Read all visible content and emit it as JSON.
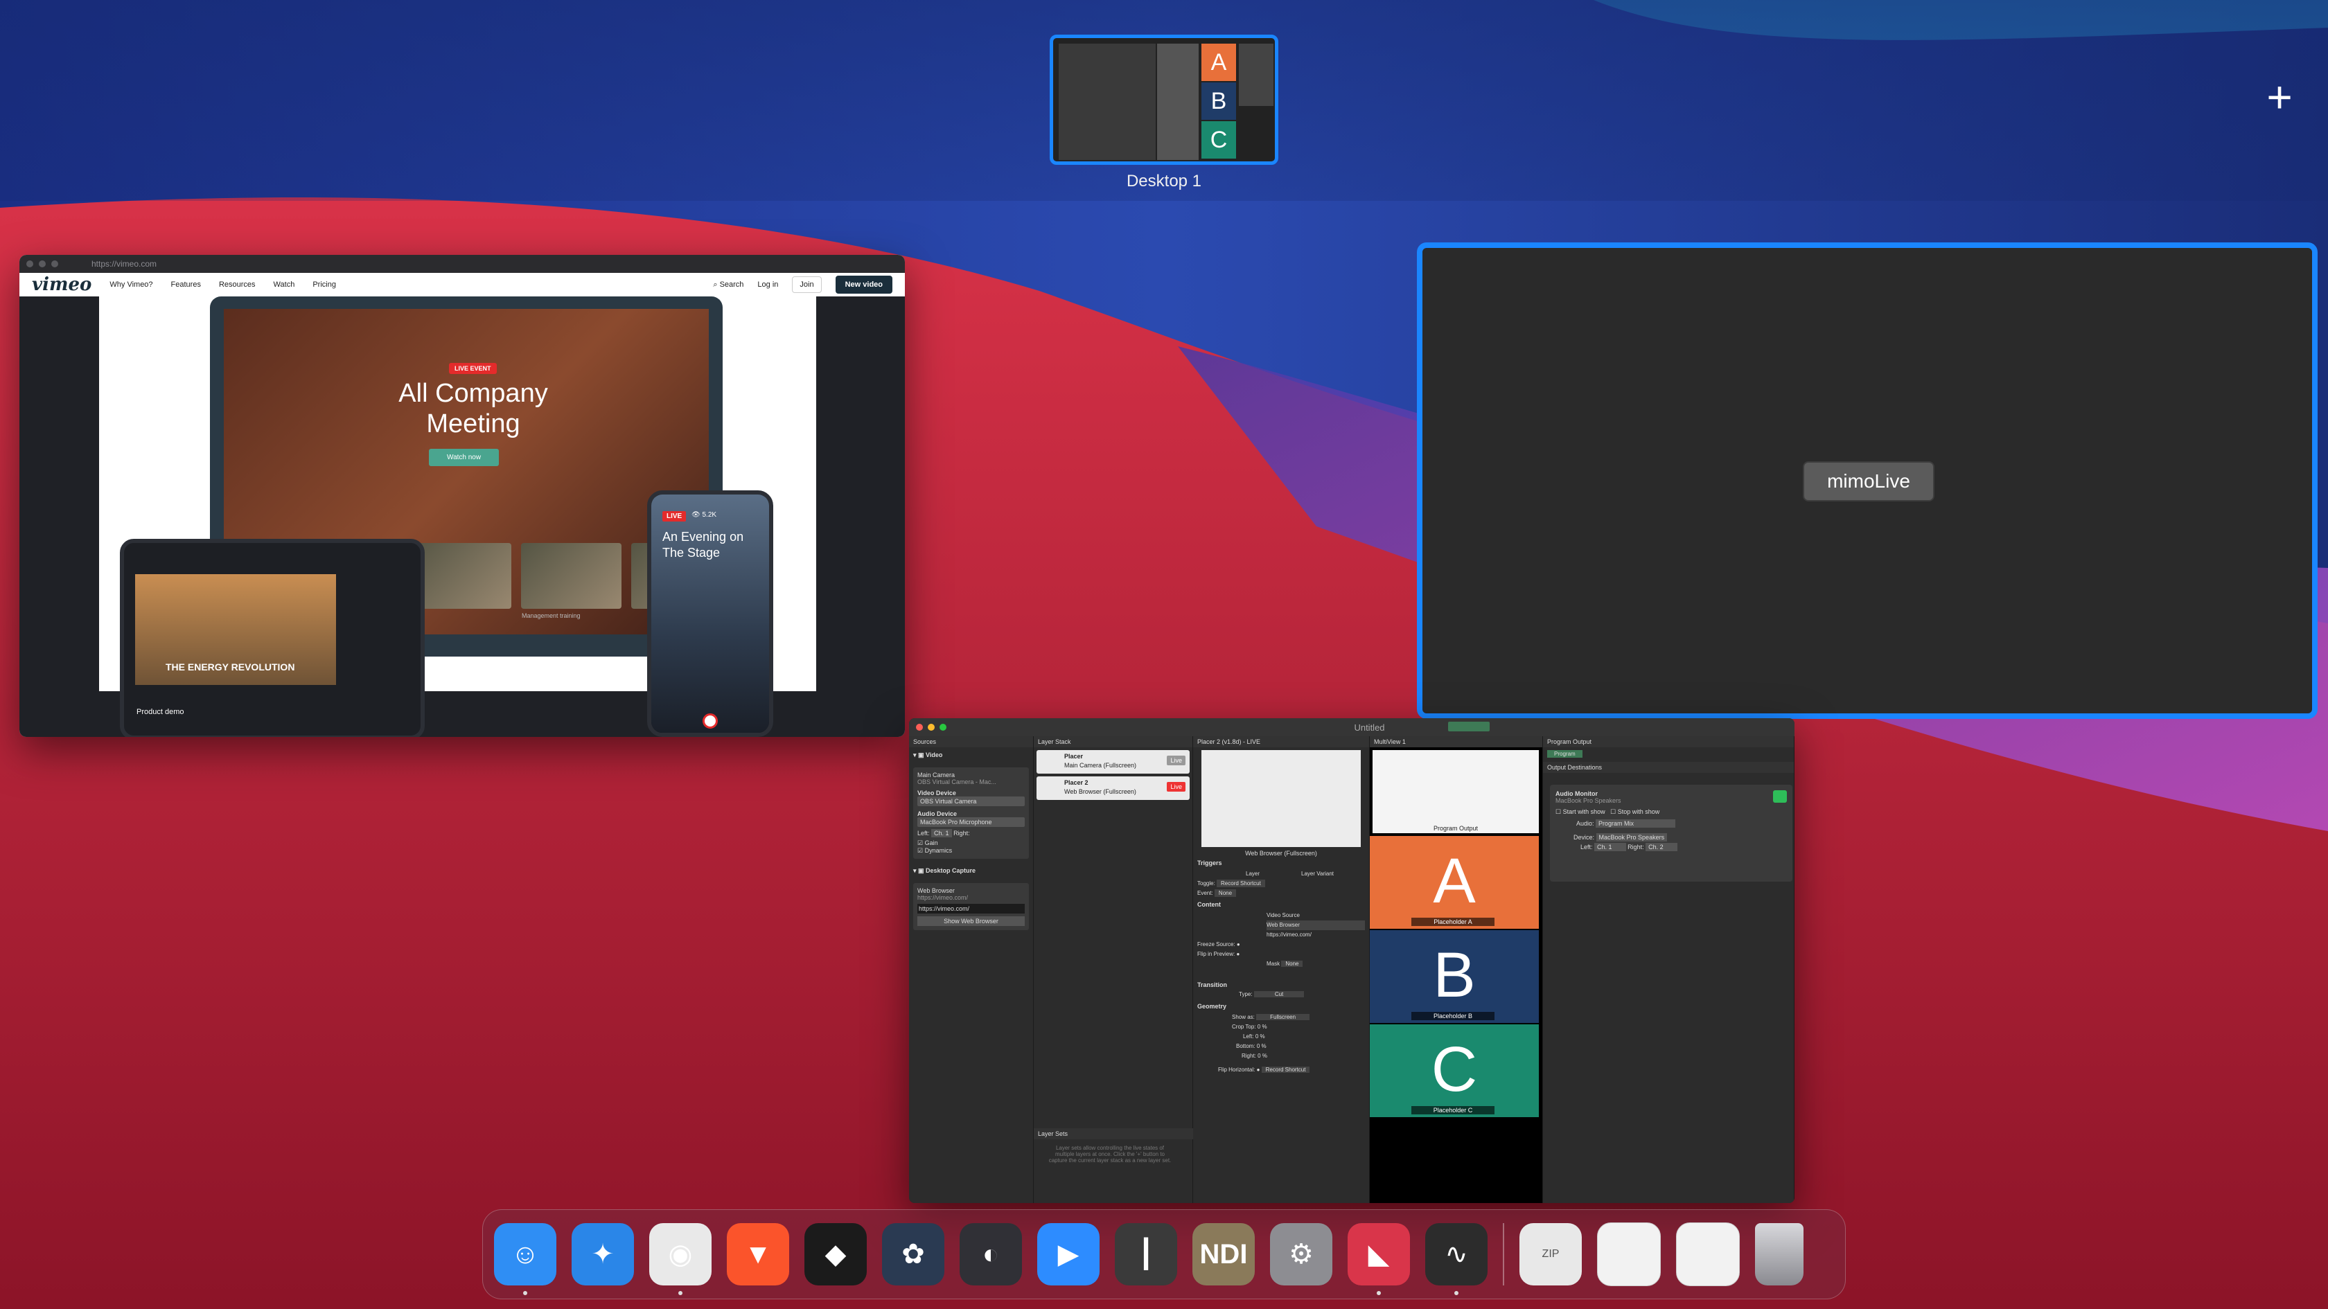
{
  "spaces": {
    "desktop_label": "Desktop 1",
    "add_label": "+",
    "thumbnail_letters": [
      "A",
      "B",
      "C"
    ]
  },
  "browser": {
    "url": "https://vimeo.com",
    "nav": {
      "logo": "vimeo",
      "items": [
        "Why Vimeo?",
        "Features",
        "Resources",
        "Watch",
        "Pricing"
      ],
      "search": "Search",
      "login": "Log in",
      "join": "Join",
      "new_video": "New video"
    },
    "hero": {
      "live_badge": "LIVE EVENT",
      "title": "All Company Meeting",
      "watch_now": "Watch now",
      "thumb_caption": "Management training",
      "tablet_title": "THE ENERGY REVOLUTION",
      "tablet_caption": "Product demo",
      "phone_live": "LIVE",
      "phone_views": "5.2K",
      "phone_title": "An Evening on The Stage"
    }
  },
  "mimo_window": {
    "label": "mimoLive"
  },
  "mimo_doc": {
    "title": "Untitled",
    "sources": {
      "header": "Sources",
      "video_group": "Video",
      "main_camera": "Main Camera",
      "main_camera_sub": "OBS Virtual Camera - Mac...",
      "video_device_label": "Video Device",
      "video_device": "OBS Virtual Camera",
      "audio_device_label": "Audio Device",
      "audio_device": "MacBook Pro Microphone",
      "left": "Left:",
      "left_val": "Ch. 1",
      "right": "Right:",
      "gain": "Gain",
      "dynamics": "Dynamics",
      "desktop_group": "Desktop Capture",
      "web_browser": "Web Browser",
      "web_browser_sub": "https://vimeo.com/",
      "url_value": "https://vimeo.com/",
      "show_web_browser": "Show Web Browser"
    },
    "layer_stack": {
      "header": "Layer Stack",
      "rows": [
        {
          "name": "Placer",
          "sub": "Main Camera (Fullscreen)",
          "live": "Live"
        },
        {
          "name": "Placer 2",
          "sub": "Web Browser (Fullscreen)",
          "live": "Live"
        }
      ],
      "layer_sets": "Layer Sets",
      "layer_sets_hint": "Layer sets allow controlling the live states of multiple layers at once. Click the '+' button to capture the current layer stack as a new layer set."
    },
    "inspector": {
      "header": "Placer 2 (v1.8d) - LIVE",
      "preview_caption": "Web Browser (Fullscreen)",
      "triggers": "Triggers",
      "layer": "Layer",
      "layer_variant": "Layer Variant",
      "toggle": "Toggle:",
      "record_shortcut": "Record Shortcut",
      "event": "Event:",
      "none": "None",
      "content": "Content",
      "video_source": "Video Source",
      "video_source_val": "Web Browser",
      "video_source_url": "https://vimeo.com/",
      "freeze_source": "Freeze Source:",
      "flip_in_preview": "Flip in Preview:",
      "mask": "Mask",
      "mask_val": "None",
      "transition": "Transition",
      "type": "Type:",
      "type_val": "Cut",
      "geometry": "Geometry",
      "show_as": "Show as:",
      "show_as_val": "Fullscreen",
      "crop_top": "Crop Top:",
      "left": "Left:",
      "bottom": "Bottom:",
      "right": "Right:",
      "pct": "0 %",
      "flip_horizontal": "Flip Horizontal:"
    },
    "multiview": {
      "header": "MultiView 1",
      "program_output": "Program Output",
      "tiles": [
        {
          "letter": "A",
          "caption": "Placeholder A",
          "color": "#e8703a"
        },
        {
          "letter": "B",
          "caption": "Placeholder B",
          "color": "#1f3c68"
        },
        {
          "letter": "C",
          "caption": "Placeholder C",
          "color": "#1a8a6e"
        }
      ]
    },
    "outputs": {
      "header": "Program Output",
      "destinations": "Output Destinations",
      "program_button": "Program",
      "audio_monitor": "Audio Monitor",
      "audio_monitor_sub": "MacBook Pro Speakers",
      "start_with_show": "Start with show",
      "stop_with_show": "Stop with show",
      "audio": "Audio:",
      "audio_val": "Program Mix",
      "device": "Device:",
      "device_val": "MacBook Pro Speakers",
      "left": "Left:",
      "left_val": "Ch. 1",
      "right": "Right:",
      "right_val": "Ch. 2"
    }
  },
  "dock": {
    "apps": [
      {
        "name": "finder",
        "glyph": "☺",
        "color": "#2f8ef4",
        "running": true
      },
      {
        "name": "safari",
        "glyph": "✦",
        "color": "#2a86e8",
        "running": false
      },
      {
        "name": "chrome",
        "glyph": "◉",
        "color": "#e9e9e9",
        "running": true
      },
      {
        "name": "brave",
        "glyph": "▼",
        "color": "#fb542b",
        "running": false
      },
      {
        "name": "final-cut",
        "glyph": "◆",
        "color": "#1b1b1b",
        "running": false
      },
      {
        "name": "davinci",
        "glyph": "✿",
        "color": "#2a3a52",
        "running": false
      },
      {
        "name": "obs",
        "glyph": "◐",
        "color": "#303036",
        "running": false
      },
      {
        "name": "zoom",
        "glyph": "▶",
        "color": "#2d8cff",
        "running": false
      },
      {
        "name": "mixer",
        "glyph": "┃",
        "color": "#3a3a3a",
        "running": false
      },
      {
        "name": "ndi",
        "glyph": "NDI",
        "color": "#8a7a5a",
        "running": false
      },
      {
        "name": "system-preferences",
        "glyph": "⚙",
        "color": "#8d8d92",
        "running": false
      },
      {
        "name": "mimolive",
        "glyph": "◣",
        "color": "#d9354a",
        "running": true
      },
      {
        "name": "activity-monitor",
        "glyph": "∿",
        "color": "#2c2c2c",
        "running": true
      }
    ],
    "zip_label": "ZIP"
  }
}
